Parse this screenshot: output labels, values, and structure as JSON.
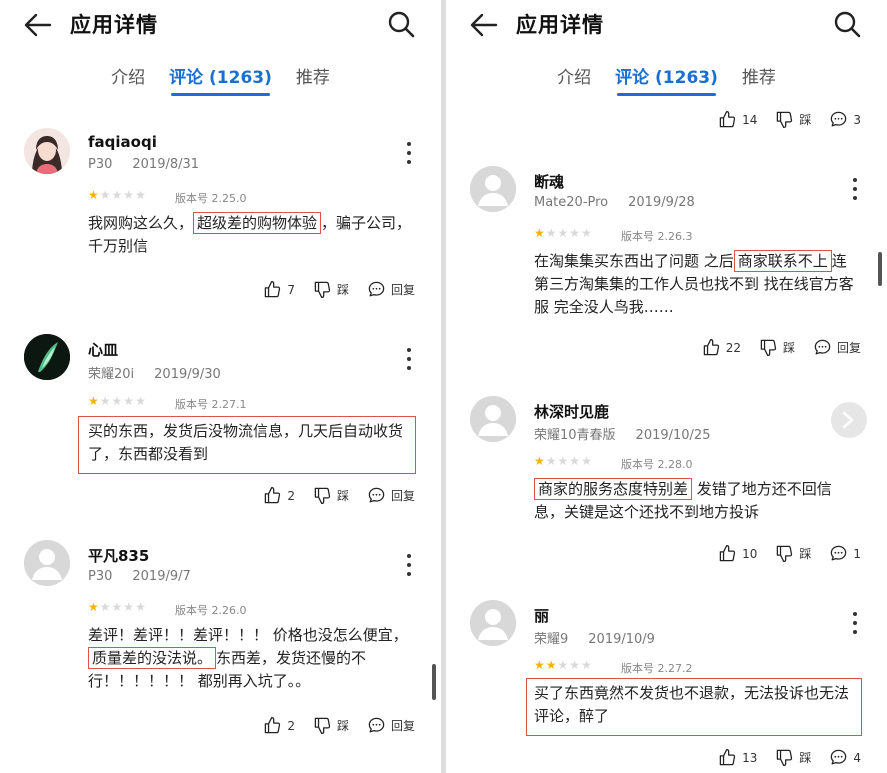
{
  "left": {
    "title": "应用详情",
    "tabs": [
      "介绍",
      "评论 (1263)",
      "推荐"
    ],
    "reviews": [
      {
        "user": "faqiaoqi",
        "device": "P30",
        "date": "2019/8/31",
        "version": "版本号 2.25.0",
        "stars": 1,
        "text_before": "我网购这么久，",
        "text_hl": "超级差的购物体验",
        "text_after": "，骗子公司，千万别信",
        "likes": "7",
        "dislike": "踩",
        "reply": "回复"
      },
      {
        "user": "心皿",
        "device": "荣耀20i",
        "date": "2019/9/30",
        "version": "版本号 2.27.1",
        "stars": 1,
        "text": "买的东西，发货后没物流信息，几天后自动收货了，东西都没看到",
        "likes": "2",
        "dislike": "踩",
        "reply": "回复"
      },
      {
        "user": "平凡835",
        "device": "P30",
        "date": "2019/9/7",
        "version": "版本号 2.26.0",
        "stars": 1,
        "text_before": "差评！差评！！差评！！！ 价格也没怎么便宜，",
        "text_hl": "质量差的没法说。",
        "text_after": "东西差，发货还慢的不行！！！！！！ 都别再入坑了。。",
        "likes": "2",
        "dislike": "踩",
        "reply": "回复"
      }
    ]
  },
  "right": {
    "title": "应用详情",
    "tabs": [
      "介绍",
      "评论 (1263)",
      "推荐"
    ],
    "top_actions": {
      "likes": "14",
      "dislike": "踩",
      "comments": "3"
    },
    "reviews": [
      {
        "user": "断魂",
        "device": "Mate20-Pro",
        "date": "2019/9/28",
        "version": "版本号 2.26.3",
        "stars": 1,
        "text_before": "在淘集集买东西出了问题 之后",
        "text_hl": "商家联系不上",
        "text_after": "连第三方淘集集的工作人员也找不到 找在线官方客服  完全没人鸟我……",
        "likes": "22",
        "dislike": "踩",
        "reply": "回复"
      },
      {
        "user": "林深时见鹿",
        "device": "荣耀10青春版",
        "date": "2019/10/25",
        "version": "版本号 2.28.0",
        "stars": 1,
        "text_hl": "商家的服务态度特别差",
        "text_after": " 发错了地方还不回信息，关键是这个还找不到地方投诉",
        "likes": "10",
        "dislike": "踩",
        "comments": "1"
      },
      {
        "user": "丽",
        "device": "荣耀9",
        "date": "2019/10/9",
        "version": "版本号 2.27.2",
        "stars": 2,
        "text": "买了东西竟然不发货也不退款，无法投诉也无法评论，醉了",
        "likes": "13",
        "dislike": "踩",
        "comments": "4"
      }
    ]
  }
}
